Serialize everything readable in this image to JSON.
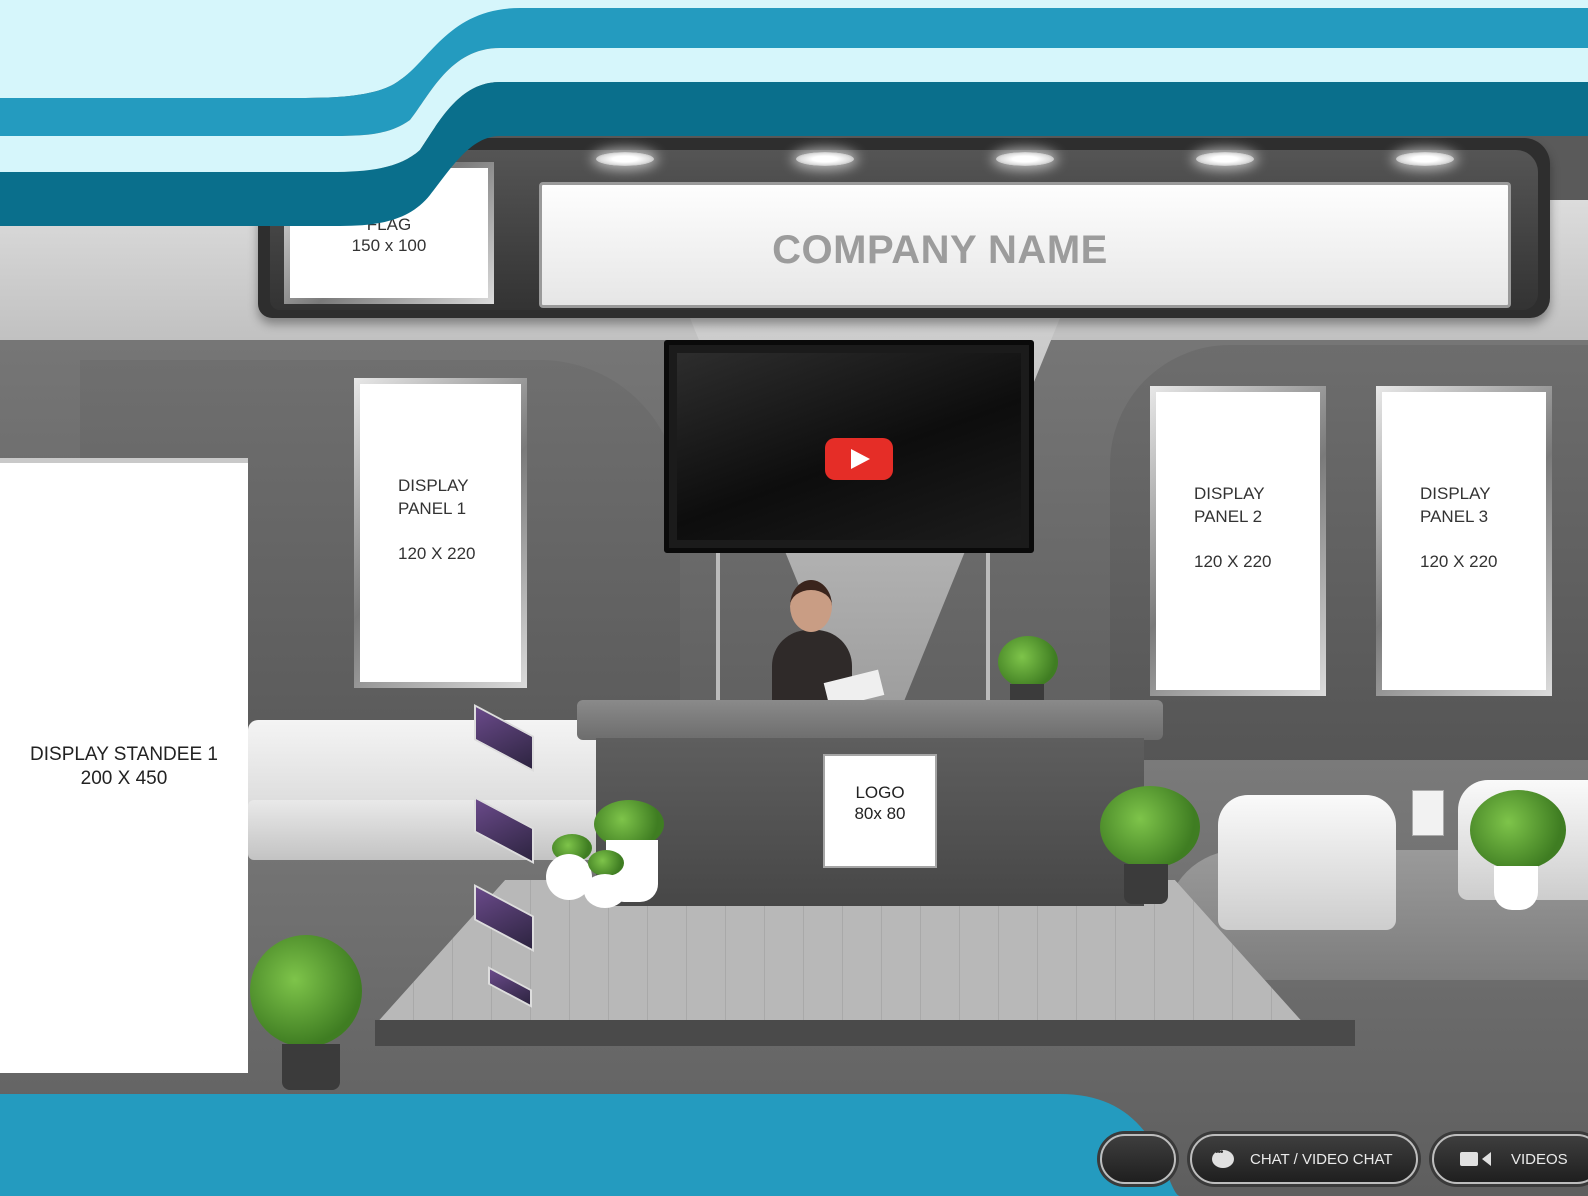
{
  "booth": {
    "company_name": "COMPANY NAME",
    "flag": {
      "label": "FLAG",
      "size": "150 x 100"
    },
    "video": {
      "icon": "youtube-play-icon"
    },
    "display_panels": [
      {
        "line1": "DISPLAY",
        "line2": "PANEL 1",
        "size": "120 X 220"
      },
      {
        "line1": "DISPLAY",
        "line2": "PANEL 2",
        "size": "120 X 220"
      },
      {
        "line1": "DISPLAY",
        "line2": "PANEL 3",
        "size": "120 X 220"
      }
    ],
    "standee": {
      "label": "DISPLAY STANDEE 1",
      "size": "200 X 450"
    },
    "logo": {
      "label": "LOGO",
      "size": "80x 80"
    }
  },
  "toolbar": {
    "chat_label": "CHAT / VIDEO CHAT",
    "chat_icon": "chat-bubble-icon",
    "videos_label": "VIDEOS",
    "videos_icon": "video-camera-icon"
  },
  "colors": {
    "wave_light": "#d6f6fb",
    "wave_mid": "#249bbf",
    "wave_dark": "#0a6f8c",
    "youtube_red": "#e52d27"
  }
}
